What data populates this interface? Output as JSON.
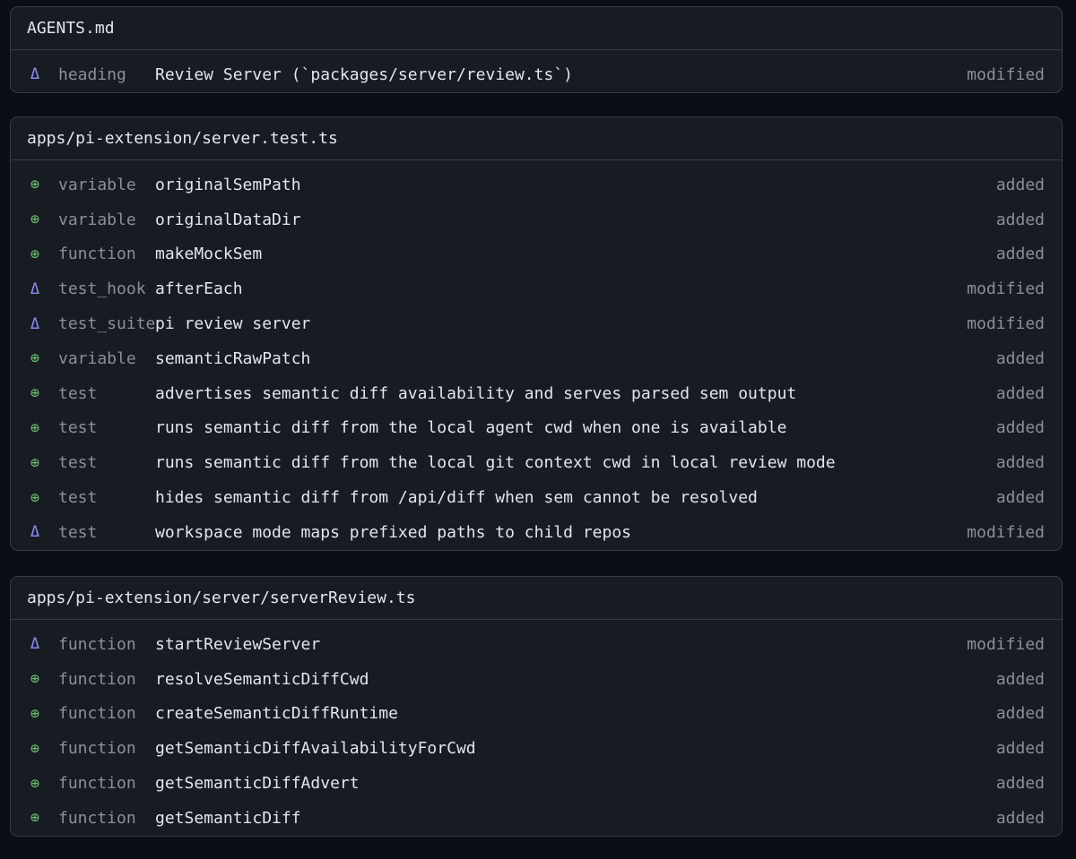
{
  "files": [
    {
      "path": "AGENTS.md",
      "changes": [
        {
          "marker": "Δ",
          "type": "modified",
          "kind": "heading",
          "name": "Review Server (`packages/server/review.ts`)",
          "status": "modified"
        }
      ]
    },
    {
      "path": "apps/pi-extension/server.test.ts",
      "changes": [
        {
          "marker": "⊕",
          "type": "added",
          "kind": "variable",
          "name": "originalSemPath",
          "status": "added"
        },
        {
          "marker": "⊕",
          "type": "added",
          "kind": "variable",
          "name": "originalDataDir",
          "status": "added"
        },
        {
          "marker": "⊕",
          "type": "added",
          "kind": "function",
          "name": "makeMockSem",
          "status": "added"
        },
        {
          "marker": "Δ",
          "type": "modified",
          "kind": "test_hook",
          "name": "afterEach",
          "status": "modified"
        },
        {
          "marker": "Δ",
          "type": "modified",
          "kind": "test_suite",
          "name": "pi review server",
          "status": "modified"
        },
        {
          "marker": "⊕",
          "type": "added",
          "kind": "variable",
          "name": "semanticRawPatch",
          "status": "added"
        },
        {
          "marker": "⊕",
          "type": "added",
          "kind": "test",
          "name": "advertises semantic diff availability and serves parsed sem output",
          "status": "added"
        },
        {
          "marker": "⊕",
          "type": "added",
          "kind": "test",
          "name": "runs semantic diff from the local agent cwd when one is available",
          "status": "added"
        },
        {
          "marker": "⊕",
          "type": "added",
          "kind": "test",
          "name": "runs semantic diff from the local git context cwd in local review mode",
          "status": "added"
        },
        {
          "marker": "⊕",
          "type": "added",
          "kind": "test",
          "name": "hides semantic diff from /api/diff when sem cannot be resolved",
          "status": "added"
        },
        {
          "marker": "Δ",
          "type": "modified",
          "kind": "test",
          "name": "workspace mode maps prefixed paths to child repos",
          "status": "modified"
        }
      ]
    },
    {
      "path": "apps/pi-extension/server/serverReview.ts",
      "changes": [
        {
          "marker": "Δ",
          "type": "modified",
          "kind": "function",
          "name": "startReviewServer",
          "status": "modified"
        },
        {
          "marker": "⊕",
          "type": "added",
          "kind": "function",
          "name": "resolveSemanticDiffCwd",
          "status": "added"
        },
        {
          "marker": "⊕",
          "type": "added",
          "kind": "function",
          "name": "createSemanticDiffRuntime",
          "status": "added"
        },
        {
          "marker": "⊕",
          "type": "added",
          "kind": "function",
          "name": "getSemanticDiffAvailabilityForCwd",
          "status": "added"
        },
        {
          "marker": "⊕",
          "type": "added",
          "kind": "function",
          "name": "getSemanticDiffAdvert",
          "status": "added"
        },
        {
          "marker": "⊕",
          "type": "added",
          "kind": "function",
          "name": "getSemanticDiff",
          "status": "added"
        }
      ]
    }
  ]
}
